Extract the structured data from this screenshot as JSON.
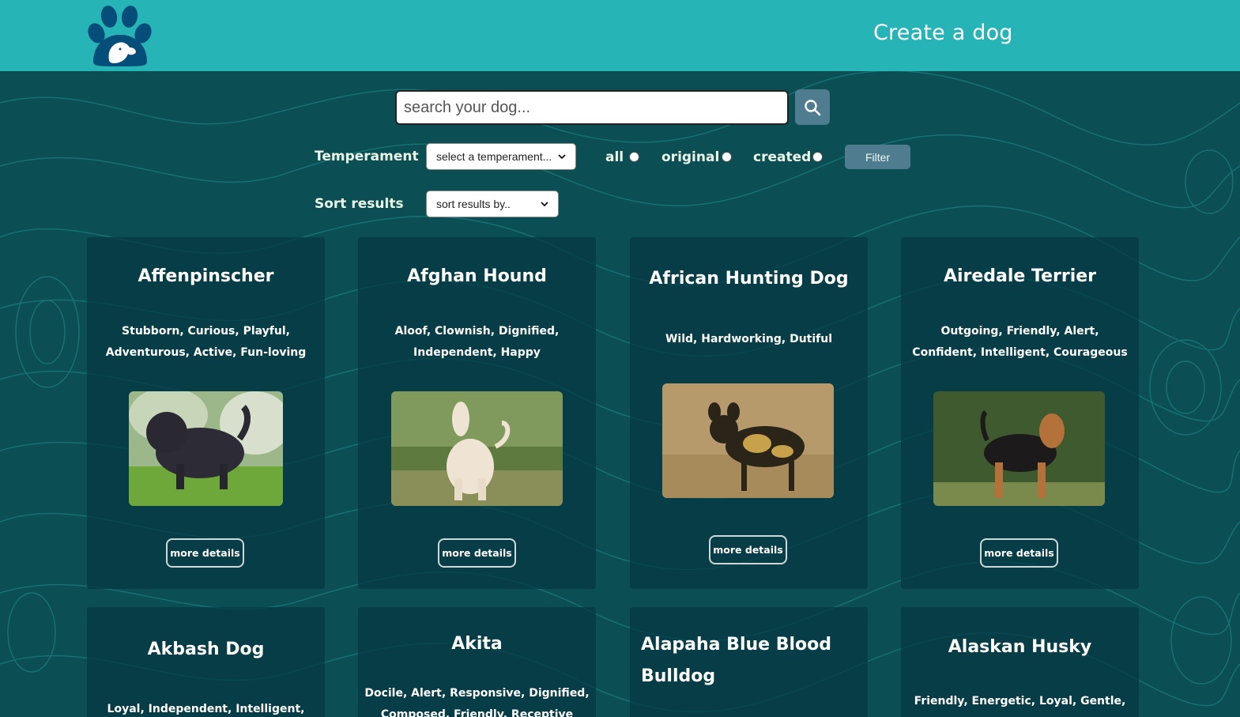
{
  "header": {
    "logo": "paw-dog-logo",
    "create_link": "Create a dog"
  },
  "search": {
    "placeholder": "search your dog...",
    "button_icon": "search-icon"
  },
  "filters": {
    "temperament_label": "Temperament",
    "temperament_select": "select a temperament...",
    "radio_all": "all",
    "radio_original": "original",
    "radio_created": "created",
    "filter_button": "Filter",
    "sort_label": "Sort results",
    "sort_select": "sort results by.."
  },
  "cards": [
    {
      "name": "Affenpinscher",
      "temperament": "Stubborn, Curious, Playful, Adventurous, Active, Fun-loving",
      "details_button": "more details"
    },
    {
      "name": "Afghan Hound",
      "temperament": "Aloof, Clownish, Dignified, Independent, Happy",
      "details_button": "more details"
    },
    {
      "name": "African Hunting Dog",
      "temperament": "Wild, Hardworking, Dutiful",
      "details_button": "more details"
    },
    {
      "name": "Airedale Terrier",
      "temperament": "Outgoing, Friendly, Alert, Confident, Intelligent, Courageous",
      "details_button": "more details"
    },
    {
      "name": "Akbash Dog",
      "temperament": "Loyal, Independent, Intelligent, Brave"
    },
    {
      "name": "Akita",
      "temperament": "Docile, Alert, Responsive, Dignified, Composed, Friendly, Receptive"
    },
    {
      "name": "Alapaha Blue Blood Bulldog",
      "temperament": ""
    },
    {
      "name": "Alaskan Husky",
      "temperament": "Friendly, Energetic, Loyal, Gentle,"
    }
  ],
  "colors": {
    "header_bg": "#26b4b6",
    "page_bg": "#0b4f55",
    "card_bg": "#043642",
    "button_bg": "#4f7c8e"
  }
}
